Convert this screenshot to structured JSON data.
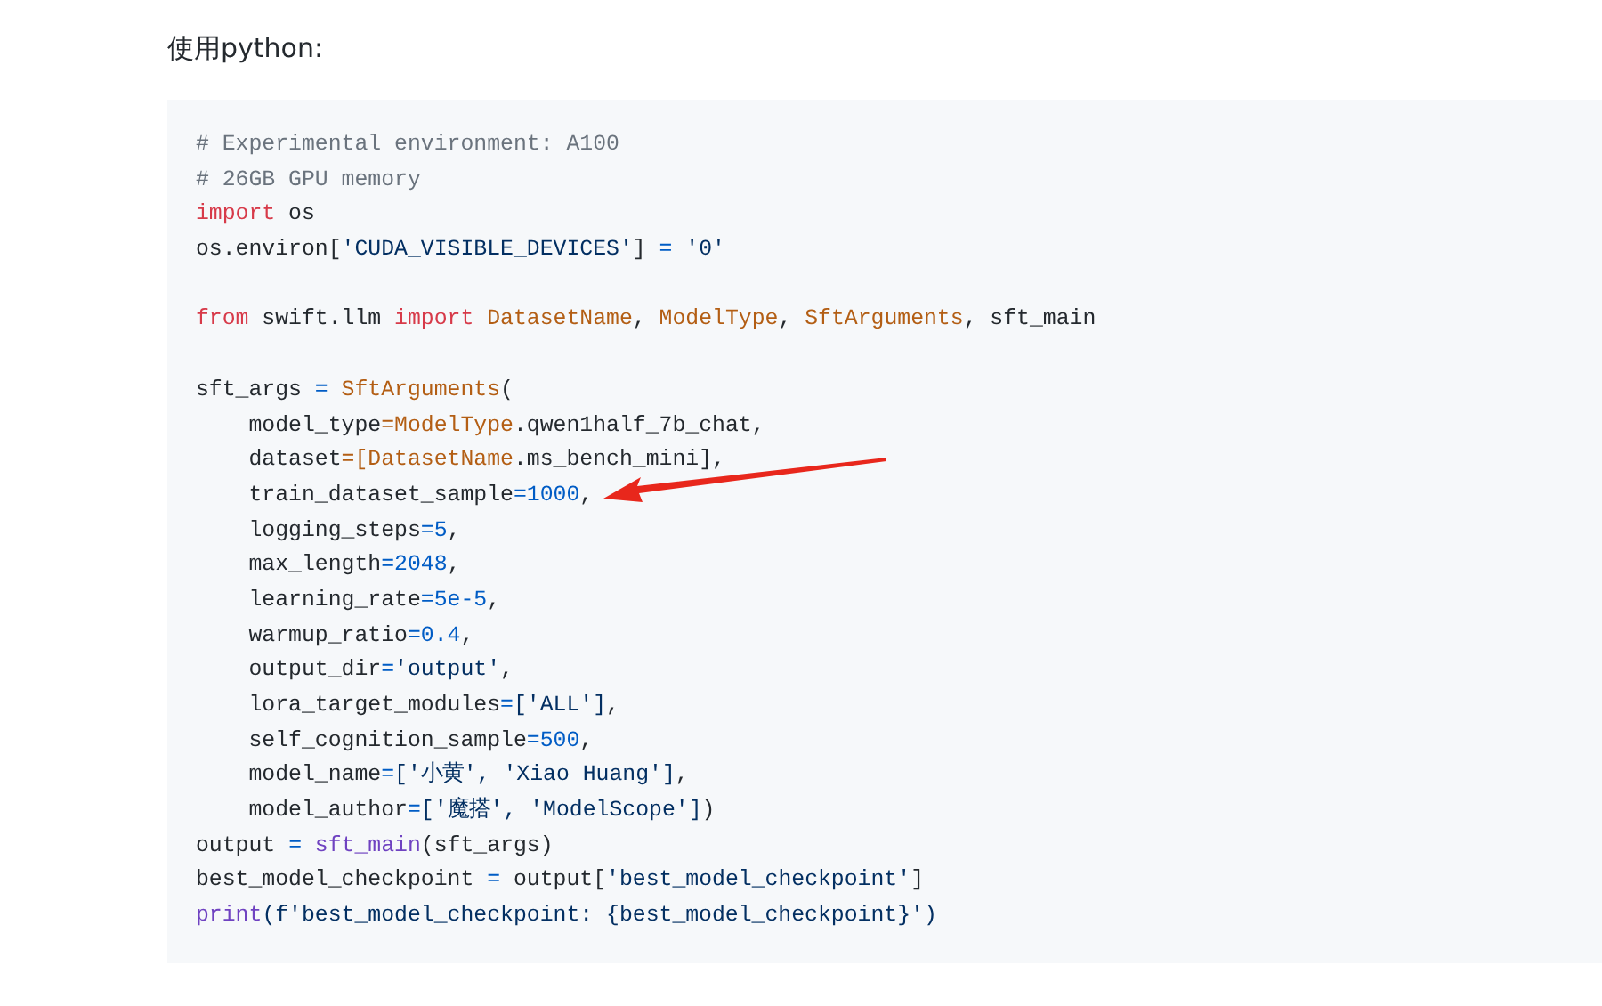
{
  "intro": "使用python:",
  "code": {
    "lines": [
      {
        "tokens": [
          {
            "text": "# Experimental environment: A100",
            "color": "#6a737d"
          }
        ]
      },
      {
        "tokens": [
          {
            "text": "# 26GB GPU memory",
            "color": "#6a737d"
          }
        ]
      },
      {
        "tokens": [
          {
            "text": "import",
            "color": "#d73a49"
          },
          {
            "text": " os",
            "color": "#24292e"
          }
        ]
      },
      {
        "tokens": [
          {
            "text": "os.environ[",
            "color": "#24292e"
          },
          {
            "text": "'CUDA_VISIBLE_DEVICES'",
            "color": "#032f62"
          },
          {
            "text": "] ",
            "color": "#24292e"
          },
          {
            "text": "=",
            "color": "#005cc5"
          },
          {
            "text": " '0'",
            "color": "#032f62"
          }
        ]
      },
      {
        "gap_before": true,
        "tokens": [
          {
            "text": "from",
            "color": "#d73a49"
          },
          {
            "text": " swift.llm ",
            "color": "#24292e"
          },
          {
            "text": "import",
            "color": "#d73a49"
          },
          {
            "text": " DatasetName",
            "color": "#b35e14"
          },
          {
            "text": ", ",
            "color": "#24292e"
          },
          {
            "text": "ModelType",
            "color": "#b35e14"
          },
          {
            "text": ", ",
            "color": "#24292e"
          },
          {
            "text": "SftArguments",
            "color": "#b35e14"
          },
          {
            "text": ", sft_main",
            "color": "#24292e"
          }
        ]
      },
      {
        "gap_before": true,
        "tokens": [
          {
            "text": "sft_args ",
            "color": "#24292e"
          },
          {
            "text": "=",
            "color": "#005cc5"
          },
          {
            "text": " SftArguments",
            "color": "#b35e14"
          },
          {
            "text": "(",
            "color": "#24292e"
          }
        ]
      },
      {
        "tokens": [
          {
            "text": "    model_type",
            "color": "#24292e"
          },
          {
            "text": "=ModelType",
            "color": "#b35e14"
          },
          {
            "text": ".qwen1half_7b_chat,",
            "color": "#24292e"
          }
        ]
      },
      {
        "tokens": [
          {
            "text": "    dataset",
            "color": "#24292e"
          },
          {
            "text": "=[DatasetName",
            "color": "#b35e14"
          },
          {
            "text": ".ms_bench_mini],",
            "color": "#24292e"
          }
        ]
      },
      {
        "tokens": [
          {
            "text": "    train_dataset_sample",
            "color": "#24292e"
          },
          {
            "text": "=1000",
            "color": "#005cc5"
          },
          {
            "text": ",",
            "color": "#24292e"
          }
        ]
      },
      {
        "tokens": [
          {
            "text": "    logging_steps",
            "color": "#24292e"
          },
          {
            "text": "=5",
            "color": "#005cc5"
          },
          {
            "text": ",",
            "color": "#24292e"
          }
        ]
      },
      {
        "tokens": [
          {
            "text": "    max_length",
            "color": "#24292e"
          },
          {
            "text": "=2048",
            "color": "#005cc5"
          },
          {
            "text": ",",
            "color": "#24292e"
          }
        ]
      },
      {
        "tokens": [
          {
            "text": "    learning_rate",
            "color": "#24292e"
          },
          {
            "text": "=5e-5",
            "color": "#005cc5"
          },
          {
            "text": ",",
            "color": "#24292e"
          }
        ]
      },
      {
        "tokens": [
          {
            "text": "    warmup_ratio",
            "color": "#24292e"
          },
          {
            "text": "=0.4",
            "color": "#005cc5"
          },
          {
            "text": ",",
            "color": "#24292e"
          }
        ]
      },
      {
        "tokens": [
          {
            "text": "    output_dir",
            "color": "#24292e"
          },
          {
            "text": "=",
            "color": "#005cc5"
          },
          {
            "text": "'output'",
            "color": "#032f62"
          },
          {
            "text": ",",
            "color": "#24292e"
          }
        ]
      },
      {
        "tokens": [
          {
            "text": "    lora_target_modules",
            "color": "#24292e"
          },
          {
            "text": "=",
            "color": "#005cc5"
          },
          {
            "text": "['ALL']",
            "color": "#032f62"
          },
          {
            "text": ",",
            "color": "#24292e"
          }
        ]
      },
      {
        "tokens": [
          {
            "text": "    self_cognition_sample",
            "color": "#24292e"
          },
          {
            "text": "=500",
            "color": "#005cc5"
          },
          {
            "text": ",",
            "color": "#24292e"
          }
        ]
      },
      {
        "tokens": [
          {
            "text": "    model_name",
            "color": "#24292e"
          },
          {
            "text": "=",
            "color": "#005cc5"
          },
          {
            "text": "['小黄', 'Xiao Huang']",
            "color": "#032f62"
          },
          {
            "text": ",",
            "color": "#24292e"
          }
        ]
      },
      {
        "tokens": [
          {
            "text": "    model_author",
            "color": "#24292e"
          },
          {
            "text": "=",
            "color": "#005cc5"
          },
          {
            "text": "['魔搭', 'ModelScope']",
            "color": "#032f62"
          },
          {
            "text": ")",
            "color": "#24292e"
          }
        ]
      },
      {
        "tokens": [
          {
            "text": "output ",
            "color": "#24292e"
          },
          {
            "text": "=",
            "color": "#005cc5"
          },
          {
            "text": " sft_main",
            "color": "#6f42c1"
          },
          {
            "text": "(sft_args)",
            "color": "#24292e"
          }
        ]
      },
      {
        "tokens": [
          {
            "text": "best_model_checkpoint ",
            "color": "#24292e"
          },
          {
            "text": "=",
            "color": "#005cc5"
          },
          {
            "text": " output[",
            "color": "#24292e"
          },
          {
            "text": "'best_model_checkpoint'",
            "color": "#032f62"
          },
          {
            "text": "]",
            "color": "#24292e"
          }
        ]
      },
      {
        "tokens": [
          {
            "text": "print",
            "color": "#6f42c1"
          },
          {
            "text": "(f'best_model_checkpoint: {best_model_checkpoint}')",
            "color": "#032f62"
          }
        ]
      }
    ]
  }
}
